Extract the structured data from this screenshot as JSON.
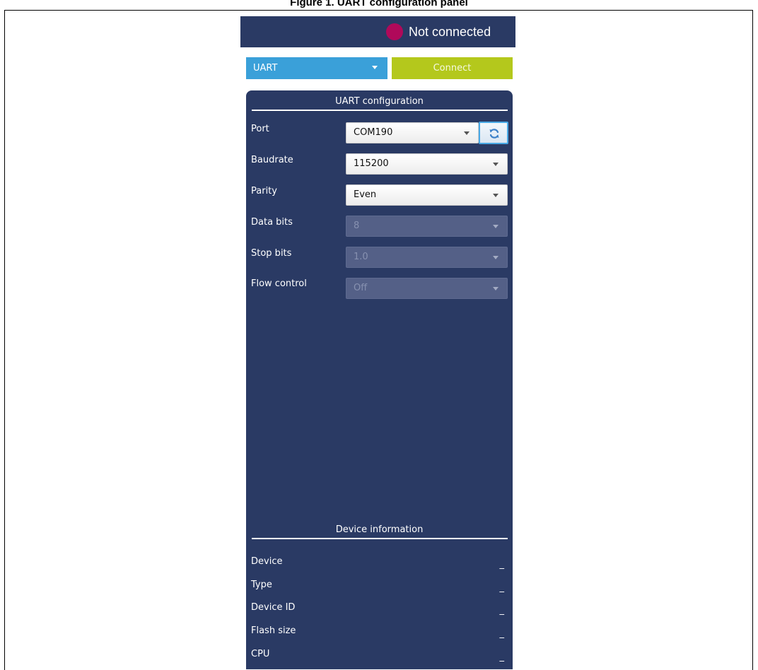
{
  "caption": "Figure 1. UART configuration panel",
  "header": {
    "status_text": "Not connected",
    "status_color": "#b0095a"
  },
  "toolbar": {
    "interface_value": "UART",
    "connect_label": "Connect"
  },
  "uart_config": {
    "title": "UART configuration",
    "fields": [
      {
        "label": "Port",
        "value": "COM190",
        "enabled": true
      },
      {
        "label": "Baudrate",
        "value": "115200",
        "enabled": true
      },
      {
        "label": "Parity",
        "value": "Even",
        "enabled": true
      },
      {
        "label": "Data bits",
        "value": "8",
        "enabled": false
      },
      {
        "label": "Stop bits",
        "value": "1.0",
        "enabled": false
      },
      {
        "label": "Flow control",
        "value": "Off",
        "enabled": false
      }
    ],
    "refresh_icon": "refresh-icon"
  },
  "device_info": {
    "title": "Device information",
    "fields": [
      {
        "label": "Device",
        "value": "_"
      },
      {
        "label": "Type",
        "value": "_"
      },
      {
        "label": "Device ID",
        "value": "_"
      },
      {
        "label": "Flash size",
        "value": "_"
      },
      {
        "label": "CPU",
        "value": "_"
      }
    ]
  },
  "colors": {
    "panel_bg": "#2a3a64",
    "select_accent": "#3aa0d9",
    "connect_accent": "#b4c81c"
  }
}
